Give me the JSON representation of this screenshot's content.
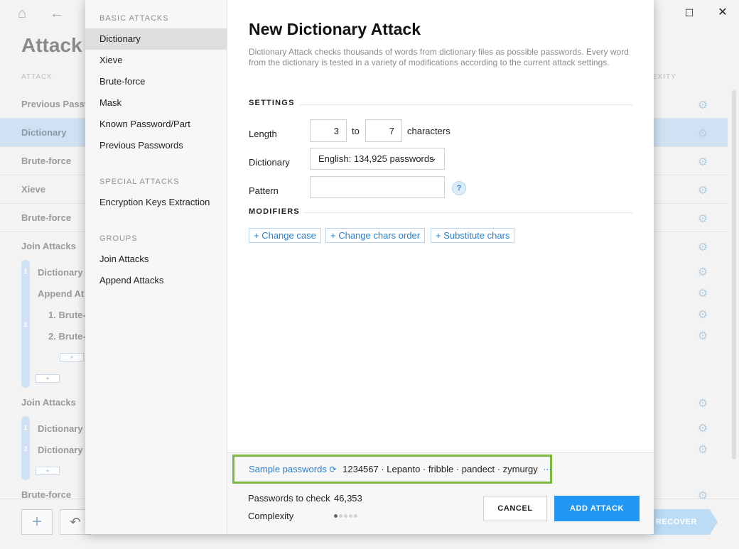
{
  "background": {
    "title": "Attack",
    "column_attack": "ATTACK",
    "column_complexity": "EXITY",
    "rows": [
      {
        "label": "Previous Passw"
      },
      {
        "label": "Dictionary"
      },
      {
        "label": "Brute-force"
      },
      {
        "label": "Xieve"
      },
      {
        "label": "Brute-force"
      },
      {
        "label": "Join Attacks"
      }
    ],
    "group1": {
      "sub1": "Dictionary",
      "sub2": "Append At",
      "sub2a": "1. Brute-",
      "sub2b": "2. Brute-",
      "num1": "1",
      "num2": "2"
    },
    "group2": {
      "title": "Join Attacks",
      "sub1": "Dictionary",
      "sub2": "Dictionary",
      "num1": "1",
      "num2": "2"
    },
    "last_row": "Brute-force",
    "plus_glyph": "+",
    "recover_label": "RECOVER"
  },
  "sidebar": {
    "basic_header": "BASIC ATTACKS",
    "basic_items": [
      "Dictionary",
      "Xieve",
      "Brute-force",
      "Mask",
      "Known Password/Part",
      "Previous Passwords"
    ],
    "special_header": "SPECIAL ATTACKS",
    "special_items": [
      "Encryption Keys Extraction"
    ],
    "groups_header": "GROUPS",
    "group_items": [
      "Join Attacks",
      "Append Attacks"
    ]
  },
  "dialog": {
    "title": "New Dictionary Attack",
    "description": "Dictionary Attack checks thousands of words from dictionary files as possible passwords. Every word from the dictionary is tested in a variety of modifications according to the current attack settings.",
    "settings_header": "SETTINGS",
    "length_label": "Length",
    "length_from": "3",
    "to_text": "to",
    "length_to": "7",
    "characters_text": "characters",
    "dictionary_label": "Dictionary",
    "dictionary_value": "English: 134,925 passwords",
    "pattern_label": "Pattern",
    "pattern_value": "",
    "help_glyph": "?",
    "modifiers_header": "MODIFIERS",
    "modifiers": [
      "+ Change case",
      "+ Change chars order",
      "+ Substitute chars"
    ],
    "sample_label": "Sample passwords",
    "samples": "1234567 · Lepanto · fribble · pandect · zymurgy",
    "passwords_to_check_label": "Passwords to check",
    "passwords_to_check_value": "46,353",
    "complexity_label": "Complexity",
    "complexity_level": 1,
    "complexity_max": 5,
    "cancel_label": "CANCEL",
    "add_label": "ADD ATTACK"
  },
  "colors": {
    "accent": "#2196f3",
    "highlight": "#7cb93e",
    "selection": "#cfe2f3"
  }
}
